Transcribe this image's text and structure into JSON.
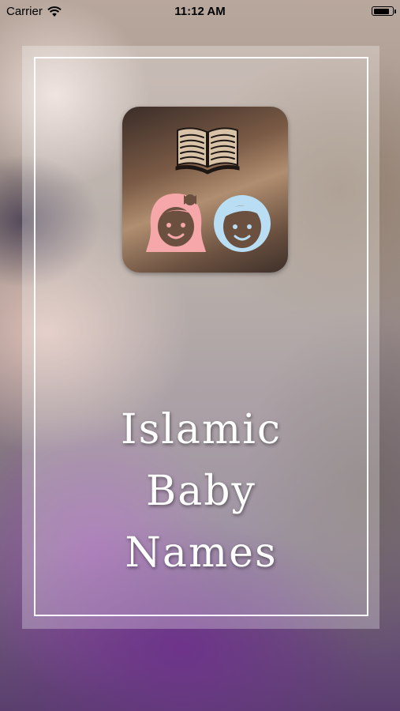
{
  "status_bar": {
    "carrier": "Carrier",
    "time": "11:12 AM"
  },
  "splash": {
    "title_lines": [
      "Islamic",
      "Baby",
      "Names"
    ]
  },
  "icons": {
    "wifi": "wifi-icon",
    "battery": "battery-icon",
    "book": "book-icon",
    "girl": "girl-face-icon",
    "boy": "boy-face-icon"
  },
  "colors": {
    "girl_pink": "#f5a7a9",
    "boy_blue": "#b9def4",
    "face_brown": "#6b4f3f",
    "text": "#ffffff"
  },
  "battery_level": 0.9
}
